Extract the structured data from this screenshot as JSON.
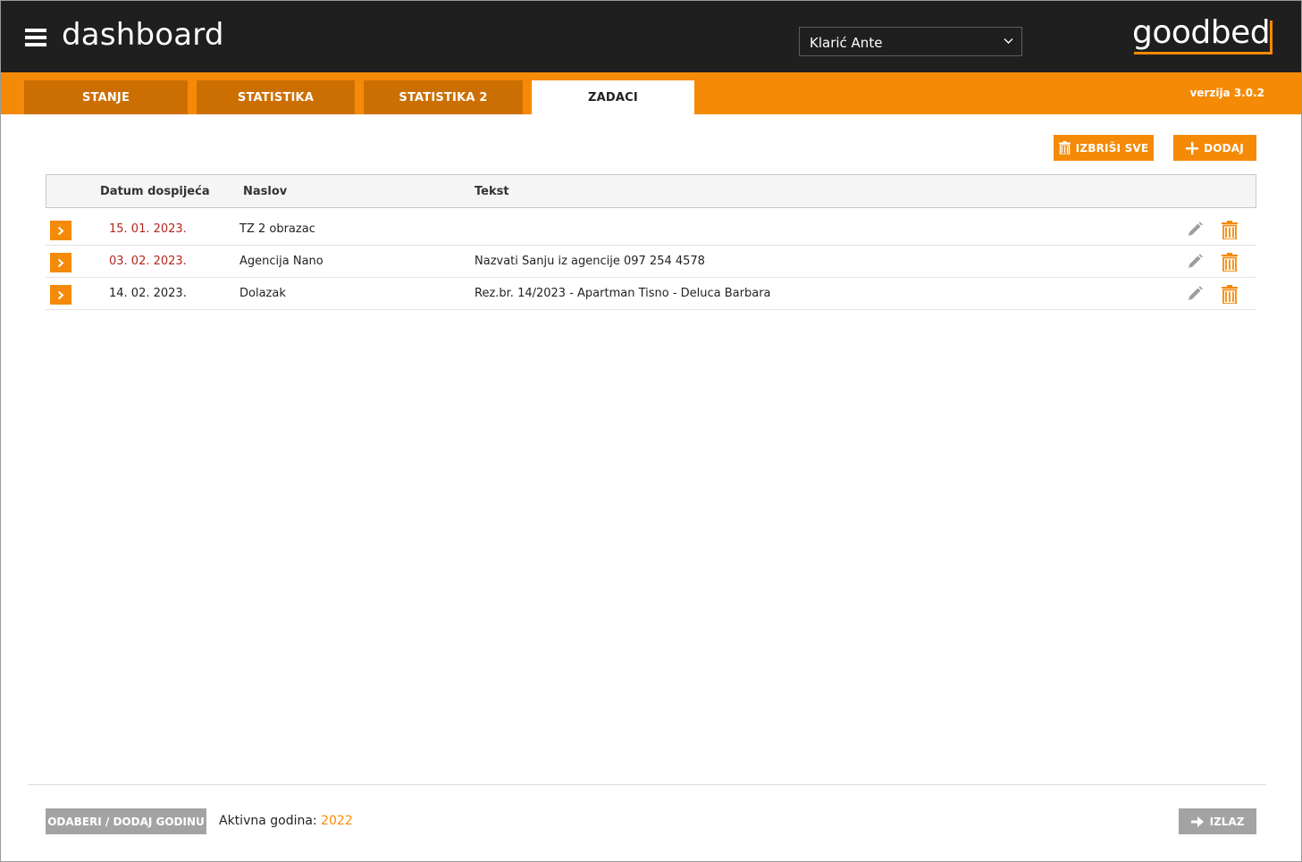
{
  "header": {
    "app_title": "dashboard",
    "user": "Klarić Ante",
    "logo": "goodbed",
    "menu_icon": "hamburger-menu-icon"
  },
  "tabs": [
    {
      "label": "STANJE",
      "active": false
    },
    {
      "label": "STATISTIKA",
      "active": false
    },
    {
      "label": "STATISTIKA 2",
      "active": false
    },
    {
      "label": "ZADACI",
      "active": true
    }
  ],
  "version": "verzija 3.0.2",
  "actions": {
    "delete_all": "IZBRIŠI SVE",
    "add": "DODAJ"
  },
  "table": {
    "columns": [
      "Datum dospijeća",
      "Naslov",
      "Tekst"
    ],
    "rows": [
      {
        "date": "15. 01. 2023.",
        "title": "TZ 2 obrazac",
        "text": "",
        "overdue": true
      },
      {
        "date": "03. 02. 2023.",
        "title": "Agencija Nano",
        "text": "Nazvati Sanju iz agencije 097 254 4578",
        "overdue": true
      },
      {
        "date": "14. 02. 2023.",
        "title": "Dolazak",
        "text": "Rez.br. 14/2023 - Apartman Tisno - Deluca Barbara",
        "overdue": false
      }
    ]
  },
  "footer": {
    "select_year": "ODABERI / DODAJ GODINU",
    "active_year_label": "Aktivna godina:",
    "active_year": "2022",
    "exit": "IZLAZ"
  },
  "colors": {
    "accent": "#f58a07",
    "tab_inactive": "#cc6f03",
    "header_bg": "#1f1f1f",
    "overdue": "#b3261e",
    "gray_button": "#a3a3a3"
  }
}
